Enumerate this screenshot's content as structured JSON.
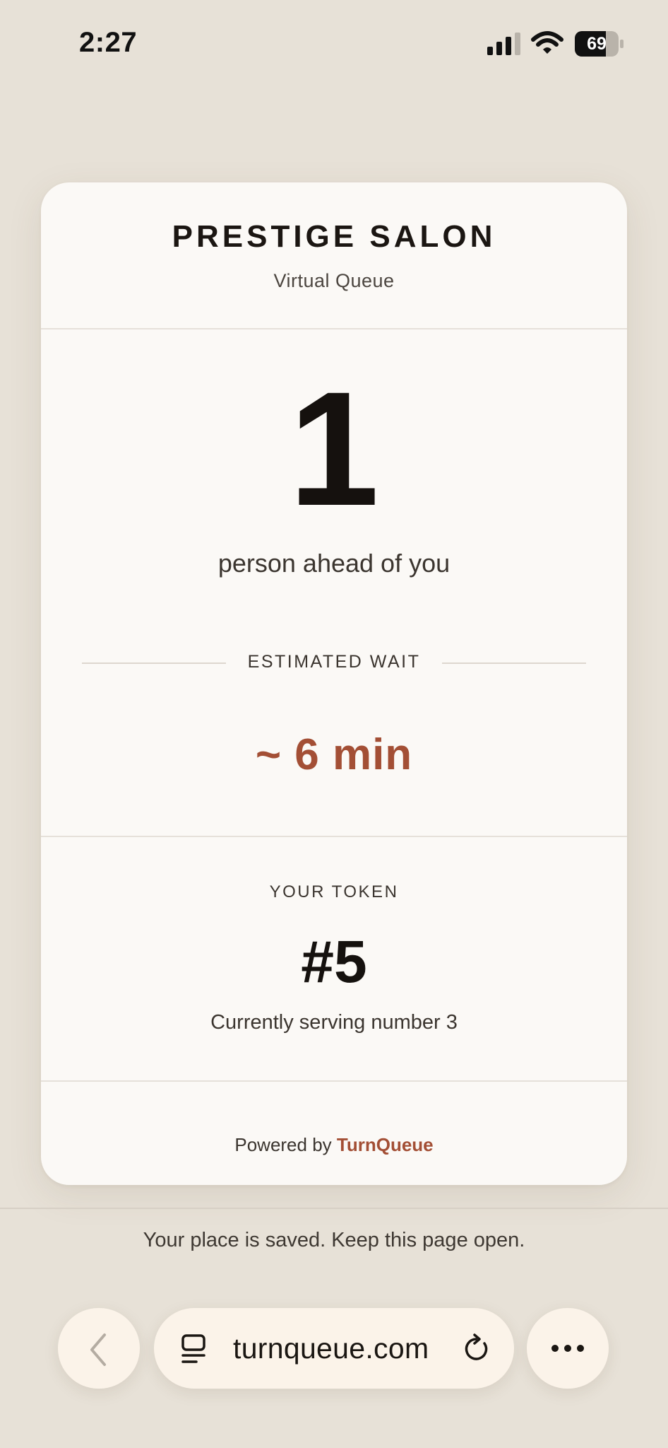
{
  "status_bar": {
    "time": "2:27",
    "battery": "69"
  },
  "card": {
    "salon_name": "PRESTIGE SALON",
    "subtitle": "Virtual Queue",
    "people_ahead": "1",
    "people_ahead_caption": "person ahead of you",
    "wait_label": "ESTIMATED WAIT",
    "wait_value": "~ 6 min",
    "token_label": "YOUR TOKEN",
    "token_number": "#5",
    "serving_text": "Currently serving number 3",
    "powered_prefix": "Powered by ",
    "powered_brand": "TurnQueue"
  },
  "saved_note": "Your place is saved. Keep this page open.",
  "browser": {
    "url": "turnqueue.com"
  },
  "colors": {
    "background": "#e7e1d7",
    "card": "#fbf9f6",
    "accent": "#a34f35"
  }
}
